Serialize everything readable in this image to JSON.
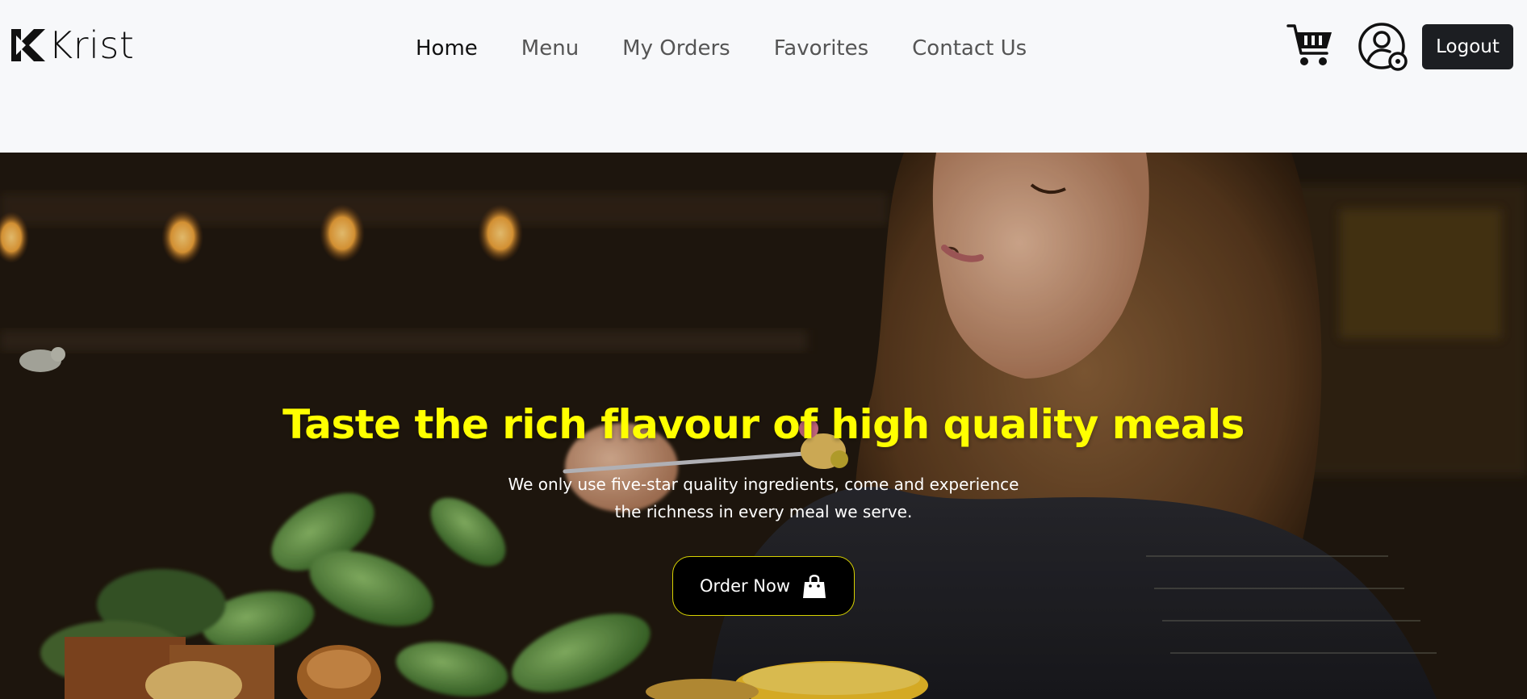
{
  "brand": {
    "name": "Krist",
    "logo_icon": "krist-k-logo-icon"
  },
  "nav": {
    "items": [
      {
        "label": "Home",
        "active": true
      },
      {
        "label": "Menu",
        "active": false
      },
      {
        "label": "My Orders",
        "active": false
      },
      {
        "label": "Favorites",
        "active": false
      },
      {
        "label": "Contact Us",
        "active": false
      }
    ]
  },
  "header_actions": {
    "cart_icon": "shopping-cart-icon",
    "profile_icon": "user-settings-icon",
    "logout_label": "Logout"
  },
  "hero": {
    "title": "Taste the rich flavour of high quality meals",
    "subtitle": "We only use five-star quality ingredients, come and experience the richness in every meal we serve.",
    "cta_label": "Order Now",
    "cta_icon": "shopping-bag-icon",
    "colors": {
      "title": "#ffff00",
      "cta_border": "#d7d200",
      "cta_bg": "#000000"
    }
  }
}
